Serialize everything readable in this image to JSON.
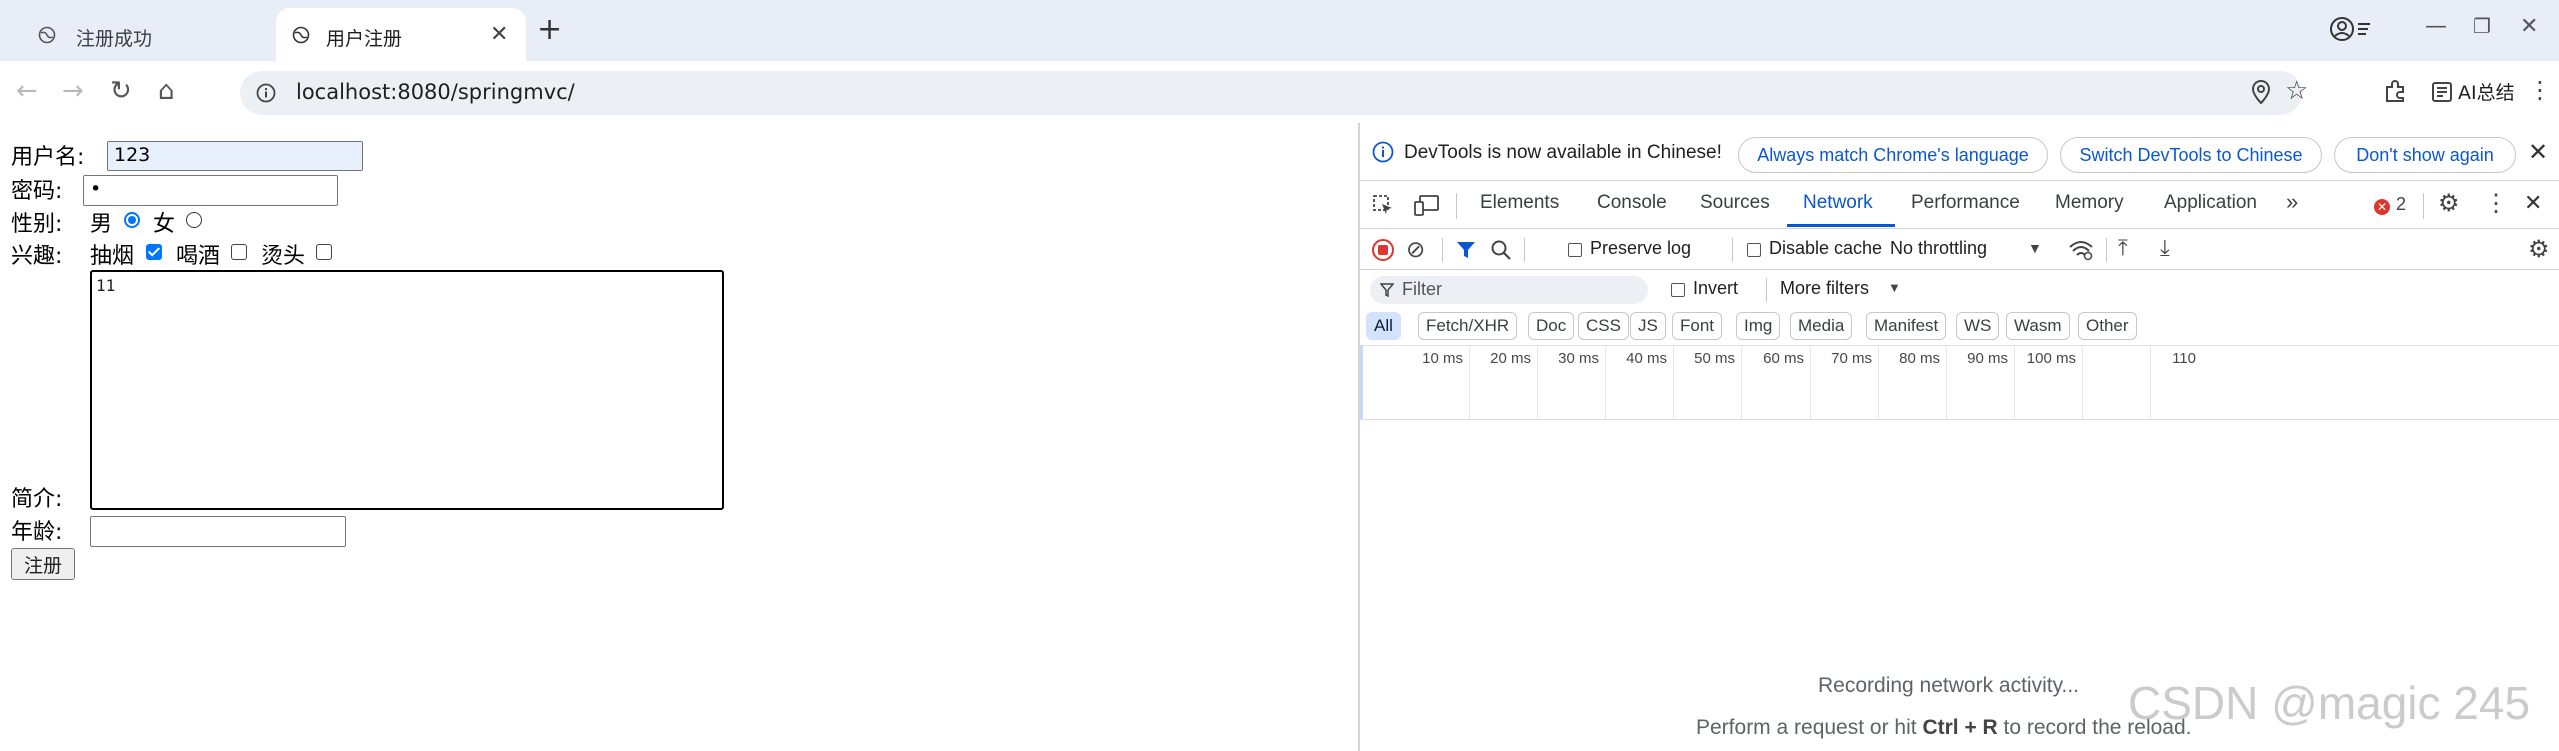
{
  "browser": {
    "tabs": [
      {
        "title": "注册成功"
      },
      {
        "title": "用户注册"
      }
    ],
    "url": "localhost:8080/springmvc/",
    "ai_label": "AI总结"
  },
  "form": {
    "username_label": "用户名:",
    "username_value": "123",
    "password_label": "密码:",
    "password_value": "•",
    "gender_label": "性别:",
    "gender_male": "男",
    "gender_female": "女",
    "hobby_label": "兴趣:",
    "hobby_smoke": "抽烟",
    "hobby_drink": "喝酒",
    "hobby_perm": "烫头",
    "intro_label": "简介:",
    "intro_value": "11",
    "age_label": "年龄:",
    "age_value": "",
    "submit_label": "注册"
  },
  "devtools": {
    "banner_text": "DevTools is now available in Chinese!",
    "banner_btn_match": "Always match Chrome's language",
    "banner_btn_switch": "Switch DevTools to Chinese",
    "banner_btn_dismiss": "Don't show again",
    "tabs": [
      "Elements",
      "Console",
      "Sources",
      "Network",
      "Performance",
      "Memory",
      "Application"
    ],
    "error_count": "2",
    "preserve_log": "Preserve log",
    "disable_cache": "Disable cache",
    "throttling": "No throttling",
    "filter_placeholder": "Filter",
    "invert": "Invert",
    "more_filters": "More filters",
    "filter_types": [
      "All",
      "Fetch/XHR",
      "Doc",
      "CSS",
      "JS",
      "Font",
      "Img",
      "Media",
      "Manifest",
      "WS",
      "Wasm",
      "Other"
    ],
    "timeline_ticks": [
      "10 ms",
      "20 ms",
      "30 ms",
      "40 ms",
      "50 ms",
      "60 ms",
      "70 ms",
      "80 ms",
      "90 ms",
      "100 ms",
      "110"
    ],
    "recording_text": "Recording network activity...",
    "hint_prefix": "Perform a request or hit ",
    "hint_keys": "Ctrl + R",
    "hint_suffix": " to record the reload."
  },
  "watermark": "CSDN @magic 245"
}
